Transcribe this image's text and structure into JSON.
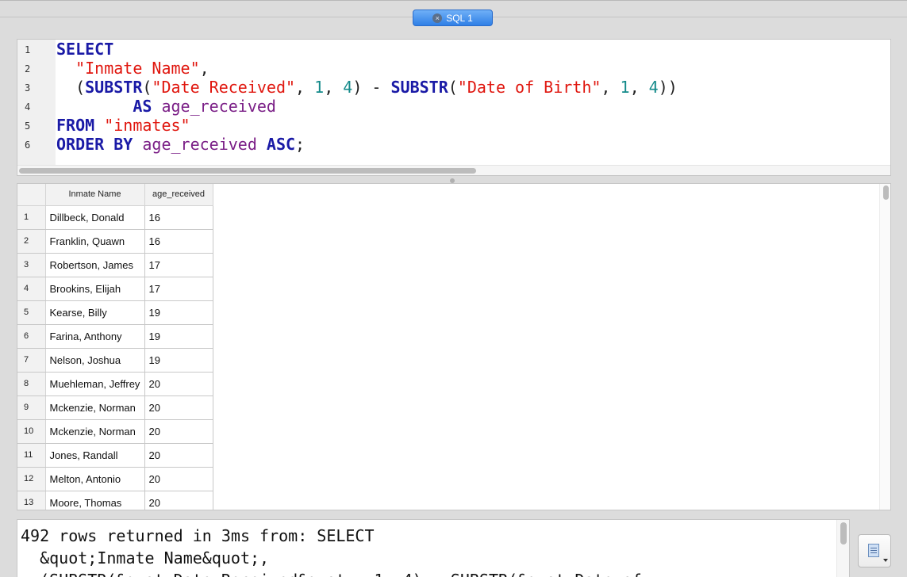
{
  "tab": {
    "label": "SQL 1",
    "close_icon": "×"
  },
  "editor": {
    "line_numbers": [
      "1",
      "2",
      "3",
      "4",
      "5",
      "6"
    ],
    "lines": [
      [
        {
          "t": "SELECT",
          "c": "kw"
        }
      ],
      [
        {
          "t": "  ",
          "c": "pl"
        },
        {
          "t": "\"Inmate Name\"",
          "c": "str"
        },
        {
          "t": ",",
          "c": "pl"
        }
      ],
      [
        {
          "t": "  (",
          "c": "pl"
        },
        {
          "t": "SUBSTR",
          "c": "fn"
        },
        {
          "t": "(",
          "c": "pl"
        },
        {
          "t": "\"Date Received\"",
          "c": "str"
        },
        {
          "t": ", ",
          "c": "pl"
        },
        {
          "t": "1",
          "c": "num"
        },
        {
          "t": ", ",
          "c": "pl"
        },
        {
          "t": "4",
          "c": "num"
        },
        {
          "t": ") - ",
          "c": "pl"
        },
        {
          "t": "SUBSTR",
          "c": "fn"
        },
        {
          "t": "(",
          "c": "pl"
        },
        {
          "t": "\"Date of Birth\"",
          "c": "str"
        },
        {
          "t": ", ",
          "c": "pl"
        },
        {
          "t": "1",
          "c": "num"
        },
        {
          "t": ", ",
          "c": "pl"
        },
        {
          "t": "4",
          "c": "num"
        },
        {
          "t": "))",
          "c": "pl"
        }
      ],
      [
        {
          "t": "        ",
          "c": "pl"
        },
        {
          "t": "AS",
          "c": "kw"
        },
        {
          "t": " ",
          "c": "pl"
        },
        {
          "t": "age_received",
          "c": "id"
        }
      ],
      [
        {
          "t": "FROM",
          "c": "kw"
        },
        {
          "t": " ",
          "c": "pl"
        },
        {
          "t": "\"inmates\"",
          "c": "str"
        }
      ],
      [
        {
          "t": "ORDER BY",
          "c": "kw"
        },
        {
          "t": " ",
          "c": "pl"
        },
        {
          "t": "age_received",
          "c": "id"
        },
        {
          "t": " ",
          "c": "pl"
        },
        {
          "t": "ASC",
          "c": "kw"
        },
        {
          "t": ";",
          "c": "pl"
        }
      ]
    ]
  },
  "results": {
    "columns": [
      "Inmate Name",
      "age_received"
    ],
    "rows": [
      {
        "idx": "1",
        "name": "Dillbeck, Donald",
        "age": "16"
      },
      {
        "idx": "2",
        "name": "Franklin, Quawn",
        "age": "16"
      },
      {
        "idx": "3",
        "name": "Robertson, James",
        "age": "17"
      },
      {
        "idx": "4",
        "name": "Brookins, Elijah",
        "age": "17"
      },
      {
        "idx": "5",
        "name": "Kearse, Billy",
        "age": "19"
      },
      {
        "idx": "6",
        "name": "Farina, Anthony",
        "age": "19"
      },
      {
        "idx": "7",
        "name": "Nelson, Joshua",
        "age": "19"
      },
      {
        "idx": "8",
        "name": "Muehleman, Jeffrey",
        "age": "20"
      },
      {
        "idx": "9",
        "name": "Mckenzie, Norman",
        "age": "20"
      },
      {
        "idx": "10",
        "name": "Mckenzie, Norman",
        "age": "20"
      },
      {
        "idx": "11",
        "name": "Jones, Randall",
        "age": "20"
      },
      {
        "idx": "12",
        "name": "Melton, Antonio",
        "age": "20"
      },
      {
        "idx": "13",
        "name": "Moore, Thomas",
        "age": "20"
      }
    ]
  },
  "message": {
    "text": "492 rows returned in 3ms from: SELECT\n  &quot;Inmate Name&quot;,\n  (SUBSTR(&quot;Date Received&quot;, 1, 4) - SUBSTR(&quot;Date of"
  },
  "colors": {
    "keyword": "#1a1aa6",
    "string": "#e0160e",
    "number": "#138a8a",
    "identifier": "#7a1e86",
    "tab_active": "#2f7fe6"
  }
}
